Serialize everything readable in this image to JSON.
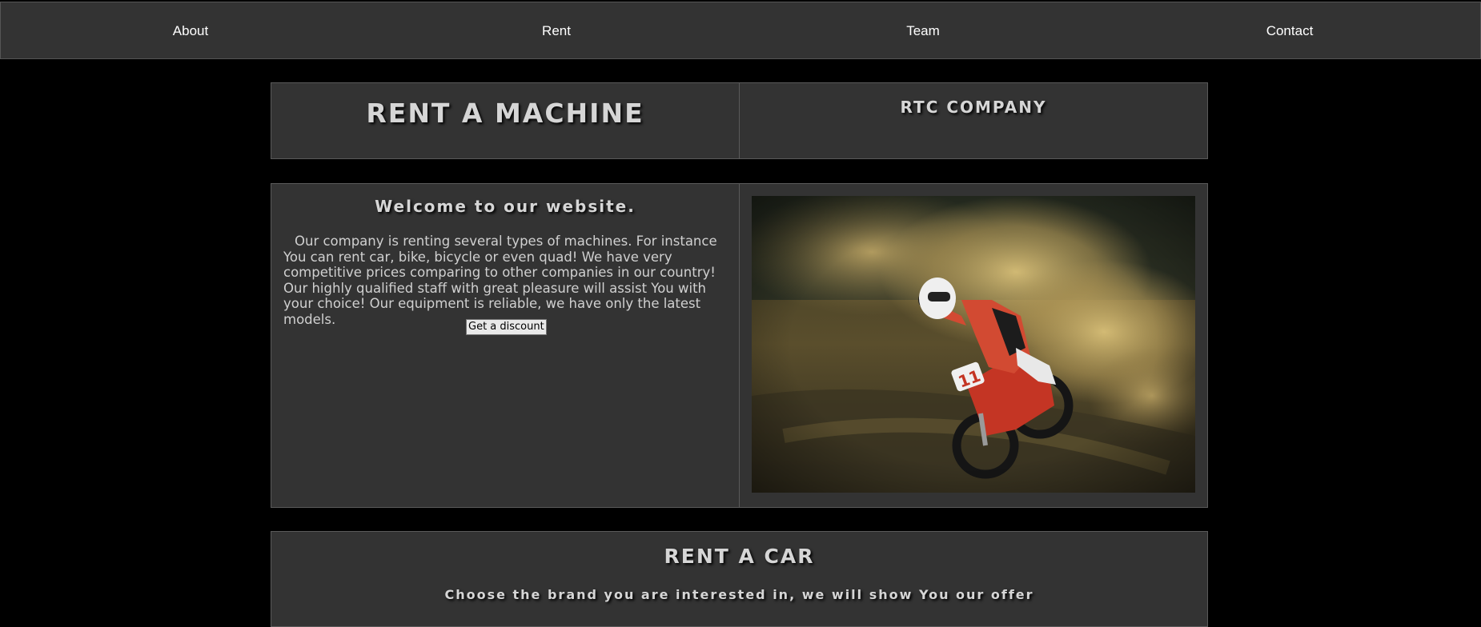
{
  "nav": {
    "about": "About",
    "rent": "Rent",
    "team": "Team",
    "contact": "Contact"
  },
  "header": {
    "title": "RENT A MACHINE",
    "company": "RTC COMPANY"
  },
  "welcome": {
    "heading": "Welcome to our website.",
    "body": "Our company is renting several types of machines. For instance You can rent car, bike, bicycle or even quad! We have very competitive prices comparing to other companies in our country! Our highly qualified staff with great pleasure will assist You with your choice! Our equipment is reliable, we have only the latest models.",
    "button_label": "Get a discount"
  },
  "hero_image": {
    "number_plate": "11"
  },
  "rent_car": {
    "heading": "RENT A CAR",
    "subheading": "Choose the brand you are interested in, we will show You our offer"
  },
  "colors": {
    "background": "#000000",
    "panel": "#333333",
    "border": "#5a5a5a",
    "heading_text": "#d6d6d6",
    "nav_text": "#ffffff"
  }
}
